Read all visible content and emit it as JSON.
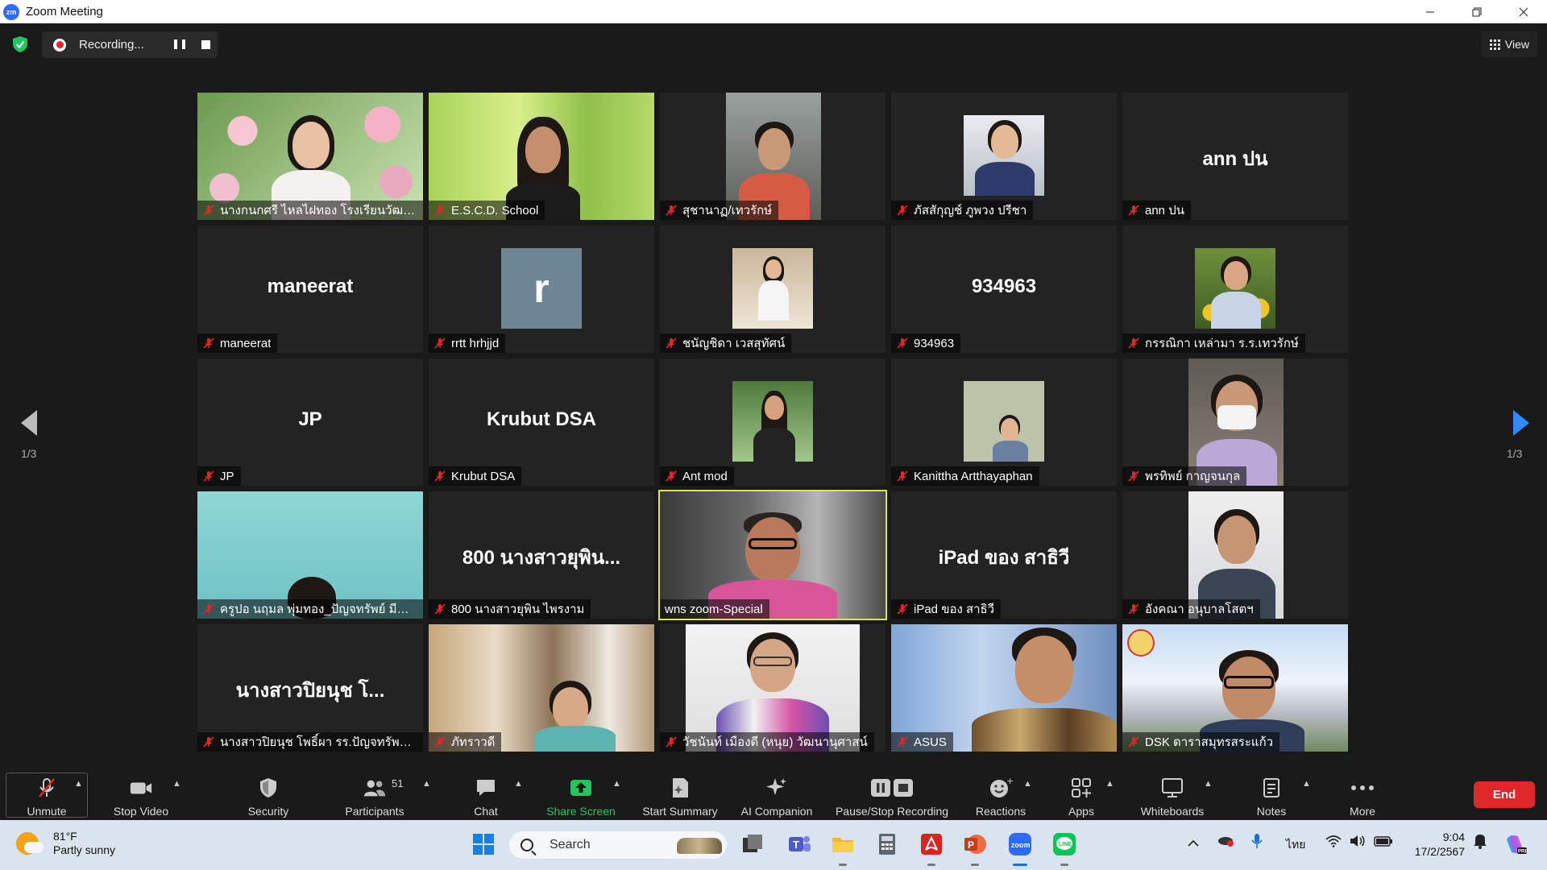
{
  "window": {
    "app_logo": "zm",
    "title": "Zoom Meeting",
    "controls": [
      "minimize-icon",
      "restore-icon",
      "close-icon"
    ]
  },
  "topbar": {
    "recording_label": "Recording...",
    "view_label": "View"
  },
  "gallery": {
    "page_indicator_left": "1/3",
    "page_indicator_right": "1/3",
    "tiles": [
      {
        "name": "นางกนกศรี ไหลไฝทอง โรงเรียนวัฒนา...",
        "muted": true,
        "display": "photo"
      },
      {
        "name": "E.S.C.D. School",
        "muted": true,
        "display": "photo"
      },
      {
        "name": "สุชานาฏ/เทวรักษ์",
        "muted": true,
        "display": "photo"
      },
      {
        "name": "ภัสสักุญช์ ภูพวง ปรีชา",
        "muted": true,
        "display": "photo"
      },
      {
        "name": "ann ปน",
        "muted": true,
        "display": "text",
        "center_text": "ann ปน"
      },
      {
        "name": "maneerat",
        "muted": true,
        "display": "text",
        "center_text": "maneerat"
      },
      {
        "name": "rrtt hrhjjd",
        "muted": true,
        "display": "letter",
        "center_text": "r"
      },
      {
        "name": "ชนัญชิดา เวสสุทัศน์",
        "muted": true,
        "display": "photo"
      },
      {
        "name": "934963",
        "muted": true,
        "display": "text",
        "center_text": "934963"
      },
      {
        "name": "กรรณิกา เหล่ามา ร.ร.เทวรักษ์",
        "muted": true,
        "display": "photo"
      },
      {
        "name": "JP",
        "muted": true,
        "display": "text",
        "center_text": "JP"
      },
      {
        "name": "Krubut DSA",
        "muted": true,
        "display": "text",
        "center_text": "Krubut DSA"
      },
      {
        "name": "Ant mod",
        "muted": true,
        "display": "photo"
      },
      {
        "name": "Kanittha Artthayaphan",
        "muted": true,
        "display": "photo"
      },
      {
        "name": "พรทิพย์ กาญจนกุล",
        "muted": true,
        "display": "photo"
      },
      {
        "name": "ครูปอ นฤมล พุ่มทอง_ปัญจทรัพย์ มีนบุรี",
        "muted": true,
        "display": "photo"
      },
      {
        "name": "800 นางสาวยุพิน ไพรงาม",
        "muted": true,
        "display": "text",
        "center_text": "800 นางสาวยุพิน..."
      },
      {
        "name": "wns zoom-Special",
        "muted": false,
        "display": "photo",
        "speaking": true
      },
      {
        "name": "iPad ของ สาธิวี",
        "muted": true,
        "display": "text",
        "center_text": "iPad ของ สาธิวี"
      },
      {
        "name": "อังคณา อนุบาลโสตฯ",
        "muted": true,
        "display": "photo"
      },
      {
        "name": "นางสาวปิยนุช โพธิ์ผา รร.ปัญจทรัพย์ดิ...",
        "muted": true,
        "display": "text",
        "center_text": "นางสาวปิยนุช โ..."
      },
      {
        "name": "ภัทราวดี",
        "muted": true,
        "display": "photo"
      },
      {
        "name": "วัชนันท์ เมืองดี (หนุย) วัฒนานุศาสน์",
        "muted": true,
        "display": "photo"
      },
      {
        "name": "ASUS",
        "muted": true,
        "display": "photo"
      },
      {
        "name": "DSK ดาราสมุทรสระแก้ว",
        "muted": true,
        "display": "photo"
      }
    ]
  },
  "toolbar": {
    "unmute": "Unmute",
    "stop_video": "Stop Video",
    "security": "Security",
    "participants": "Participants",
    "participants_count": "51",
    "chat": "Chat",
    "share_screen": "Share Screen",
    "start_summary": "Start Summary",
    "ai_companion": "AI Companion",
    "pause_stop_recording": "Pause/Stop Recording",
    "reactions": "Reactions",
    "apps": "Apps",
    "whiteboards": "Whiteboards",
    "notes": "Notes",
    "more": "More",
    "end": "End",
    "accent_color": "#22c55e",
    "end_color": "#e02828"
  },
  "taskbar": {
    "weather_temp": "81°F",
    "weather_desc": "Partly sunny",
    "search_label": "Search",
    "language": "ไทย",
    "time": "9:04",
    "date": "17/2/2567"
  }
}
